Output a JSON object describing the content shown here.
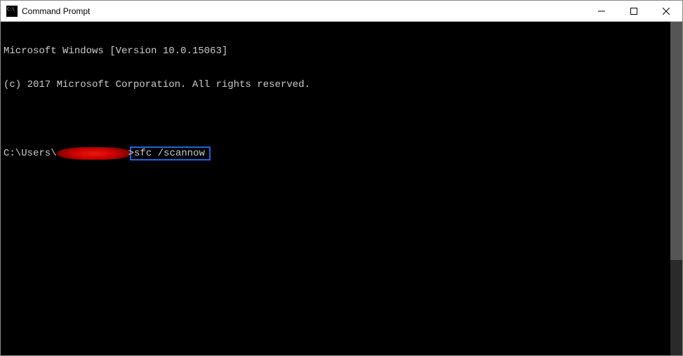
{
  "window": {
    "title": "Command Prompt"
  },
  "console": {
    "line1": "Microsoft Windows [Version 10.0.15063]",
    "line2": "(c) 2017 Microsoft Corporation. All rights reserved.",
    "prompt_prefix": "C:\\Users\\",
    "prompt_suffix": ">",
    "command": "sfc /scannow"
  }
}
